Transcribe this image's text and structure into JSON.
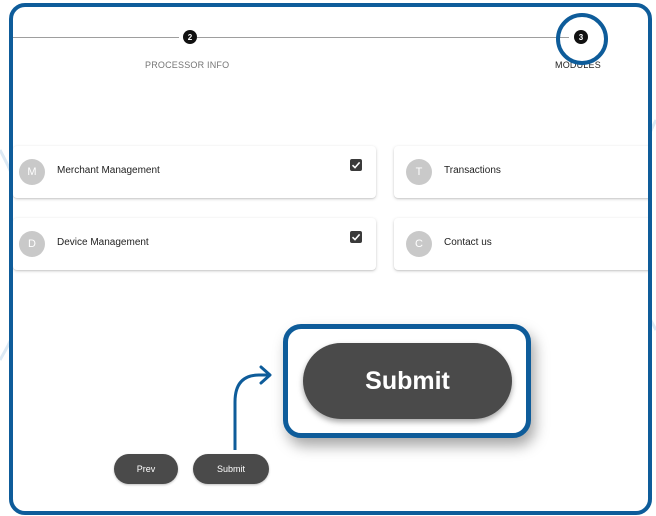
{
  "stepper": {
    "steps": [
      {
        "number": "2",
        "label": "PROCESSOR INFO"
      },
      {
        "number": "3",
        "label": "MODULES"
      }
    ]
  },
  "modules": [
    {
      "avatar": "M",
      "name": "Merchant Management",
      "checked": true
    },
    {
      "avatar": "T",
      "name": "Transactions",
      "checked": false
    },
    {
      "avatar": "D",
      "name": "Device Management",
      "checked": true
    },
    {
      "avatar": "C",
      "name": "Contact us",
      "checked": false
    }
  ],
  "actions": {
    "prev_label": "Prev",
    "submit_label": "Submit",
    "submit_zoom_label": "Submit"
  },
  "colors": {
    "highlight": "#0e5c9a",
    "button": "#4a4a4a"
  }
}
